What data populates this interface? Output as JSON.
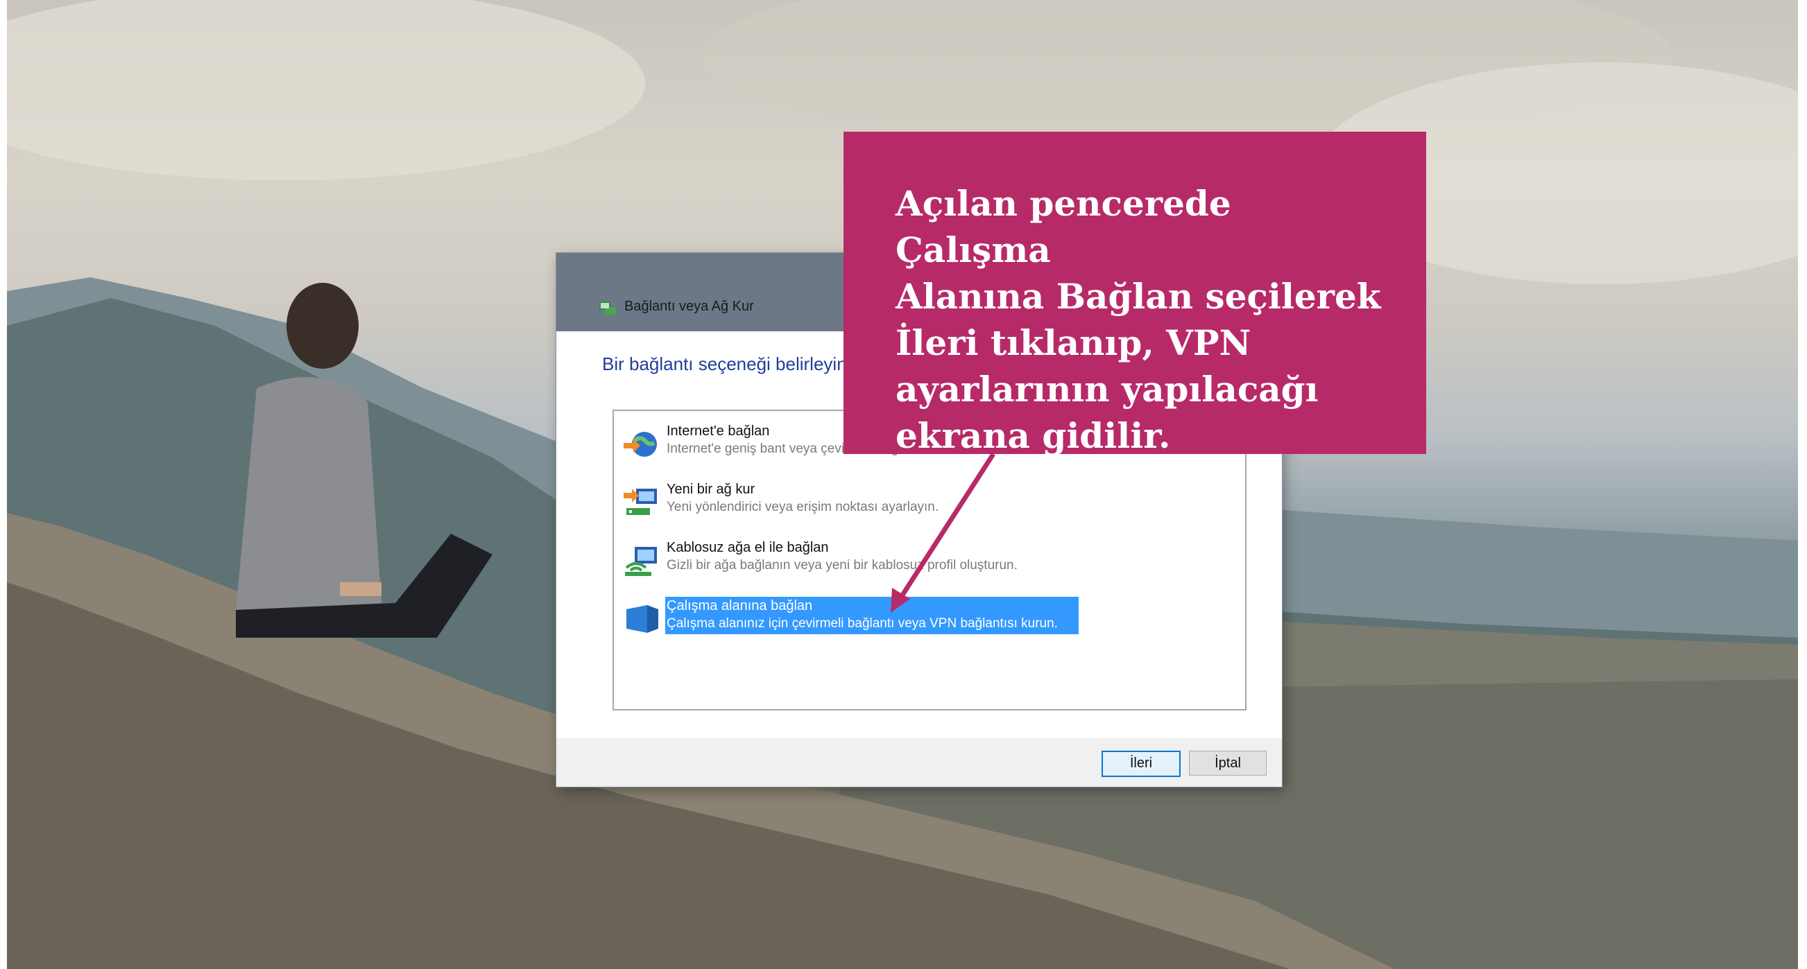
{
  "dialog": {
    "title": "Bağlantı veya Ağ Kur",
    "heading": "Bir bağlantı seçeneği belirleyin",
    "options": [
      {
        "title": "Internet'e bağlan",
        "desc": "Internet'e geniş bant veya çevirmeli bağlantı kurun.",
        "icon": "globe-icon",
        "selected": false
      },
      {
        "title": "Yeni bir ağ kur",
        "desc": "Yeni yönlendirici veya erişim noktası ayarlayın.",
        "icon": "router-icon",
        "selected": false
      },
      {
        "title": "Kablosuz ağa el ile bağlan",
        "desc": "Gizli bir ağa bağlanın veya yeni bir kablosuz profil oluşturun.",
        "icon": "wireless-icon",
        "selected": false
      },
      {
        "title": "Çalışma alanına bağlan",
        "desc": "Çalışma alanınız için çevirmeli bağlantı veya VPN bağlantısı kurun.",
        "icon": "workplace-icon",
        "selected": true
      }
    ],
    "buttons": {
      "next": "İleri",
      "cancel": "İptal"
    }
  },
  "callout": {
    "text": "Açılan pencerede Çalışma\nAlanına Bağlan seçilerek\nİleri tıklanıp, VPN\nayarlarının yapılacağı\nekrana gidilir.",
    "color": "#b72a68"
  },
  "colors": {
    "selection": "#3399ff",
    "heading": "#1f3e9c"
  }
}
